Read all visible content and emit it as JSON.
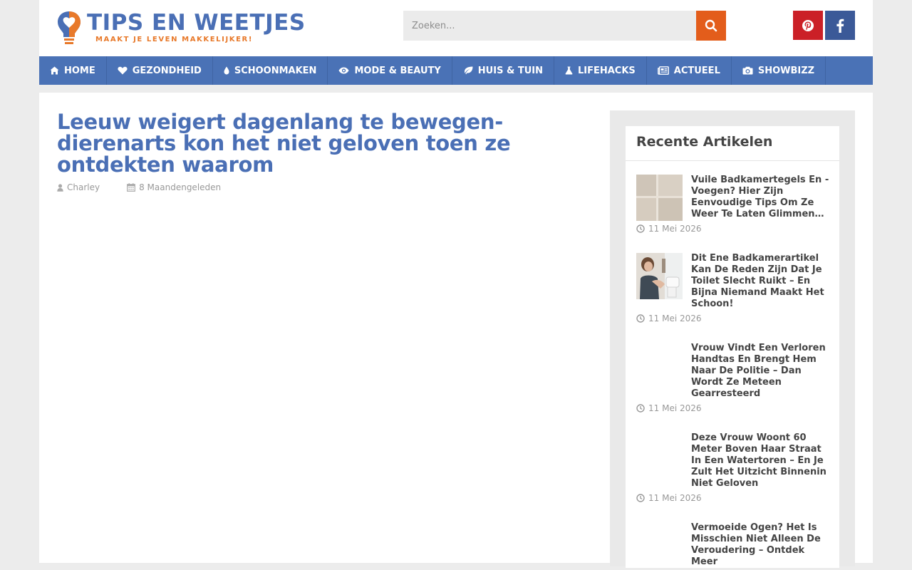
{
  "header": {
    "logo_title": "TIPS EN WEETJES",
    "logo_tagline": "MAAKT JE LEVEN MAKKELIJKER!",
    "search_placeholder": "Zoeken...",
    "colors": {
      "brand_blue": "#4a6fb5",
      "brand_orange": "#e8792a",
      "search_button": "#e35d1b",
      "pinterest": "#cb2027",
      "facebook": "#3b5998"
    }
  },
  "nav": {
    "items": [
      {
        "label": "HOME",
        "icon": "home-icon"
      },
      {
        "label": "GEZONDHEID",
        "icon": "heart-icon"
      },
      {
        "label": "SCHOONMAKEN",
        "icon": "drop-icon"
      },
      {
        "label": "MODE & BEAUTY",
        "icon": "eye-icon"
      },
      {
        "label": "HUIS & TUIN",
        "icon": "leaf-icon"
      },
      {
        "label": "LIFEHACKS",
        "icon": "flask-icon"
      },
      {
        "label": "ACTUEEL",
        "icon": "newspaper-icon"
      },
      {
        "label": "SHOWBIZZ",
        "icon": "camera-icon"
      }
    ]
  },
  "post": {
    "title": "Leeuw weigert dagenlang te bewegen- dierenarts kon het niet geloven toen ze ontdekten waarom",
    "author": "Charley",
    "date": "8 Maandengeleden"
  },
  "sidebar": {
    "widget_title": "Recente Artikelen",
    "articles": [
      {
        "title": "Vuile Badkamertegels En -Voegen? Hier Zijn Eenvoudige Tips Om Ze Weer Te Laten Glimmen…",
        "date": "11 Mei 2026",
        "thumb": "tiles"
      },
      {
        "title": "Dit Ene Badkamerartikel Kan De Reden Zijn Dat Je Toilet Slecht Ruikt – En Bijna Niemand Maakt Het Schoon!",
        "date": "11 Mei 2026",
        "thumb": "woman-toilet"
      },
      {
        "title": "Vrouw Vindt Een Verloren Handtas En Brengt Hem Naar De Politie – Dan Wordt Ze Meteen Gearresteerd",
        "date": "11 Mei 2026",
        "thumb": "none"
      },
      {
        "title": "Deze Vrouw Woont 60 Meter Boven Haar Straat In Een Watertoren – En Je Zult Het Uitzicht Binnenin Niet Geloven",
        "date": "11 Mei 2026",
        "thumb": "none"
      },
      {
        "title": "Vermoeide Ogen? Het Is Misschien Niet Alleen De Veroudering – Ontdek Meer",
        "date": "",
        "thumb": "none"
      }
    ]
  }
}
